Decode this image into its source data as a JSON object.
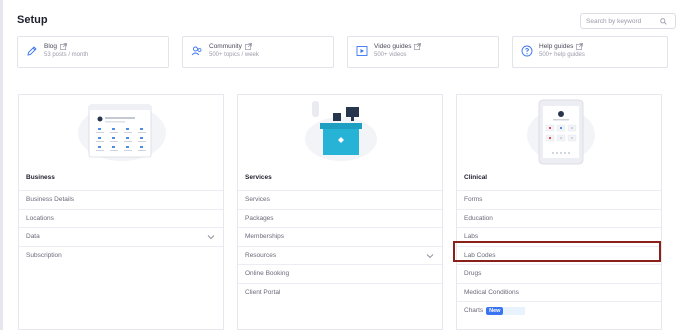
{
  "page": {
    "title": "Setup"
  },
  "search": {
    "placeholder": "Search by keyword",
    "icon": "search-icon"
  },
  "resources": [
    {
      "title": "Blog",
      "subtitle": "53 posts / month",
      "icon": "pencil-icon"
    },
    {
      "title": "Community",
      "subtitle": "500+ topics / week",
      "icon": "people-icon"
    },
    {
      "title": "Video guides",
      "subtitle": "500+ videos",
      "icon": "play-icon"
    },
    {
      "title": "Help guides",
      "subtitle": "500+ help guides",
      "icon": "help-icon"
    }
  ],
  "cards": [
    {
      "heading": "Business",
      "items": [
        "Business Details",
        "Locations",
        "Data",
        "Subscription"
      ],
      "expandable_item": "Data"
    },
    {
      "heading": "Services",
      "items": [
        "Services",
        "Packages",
        "Memberships",
        "Resources",
        "Online Booking",
        "Client Portal"
      ],
      "expandable_item": "Resources"
    },
    {
      "heading": "Clinical",
      "items": [
        "Forms",
        "Education",
        "Labs",
        "Lab Codes",
        "Drugs",
        "Medical Conditions",
        "Charts"
      ],
      "highlighted_item": "Lab Codes",
      "badge_item": "Charts",
      "badge": "New"
    }
  ],
  "colors": {
    "accent": "#3a74f0",
    "highlight_border": "#8b1f1a",
    "desk": "#27b3d6"
  }
}
